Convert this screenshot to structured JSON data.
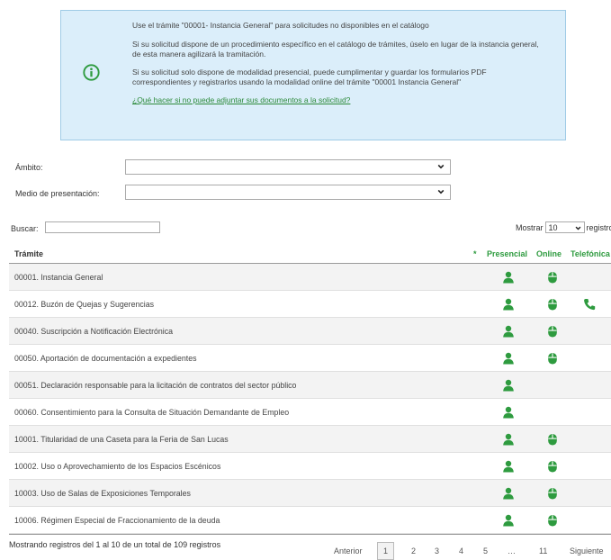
{
  "notice": {
    "line1": "Use el trámite \"00001- Instancia General\" para solicitudes no disponibles en el catálogo",
    "line2": "Si su solicitud dispone de un procedimiento específico en el catálogo de trámites, úselo en lugar de la instancia general, de esta manera agilizará la tramitación.",
    "line3": "Si su solicitud solo dispone de modalidad presencial, puede cumplimentar y guardar los formularios PDF correspondientes y registrarlos usando la modalidad online del trámite \"00001 Instancia General\"",
    "link": "¿Qué hacer si no puede adjuntar sus documentos a la solicitud?"
  },
  "filters": {
    "ambito_label": "Ámbito:",
    "ambito_value": "",
    "medio_label": "Medio de presentación:",
    "medio_value": ""
  },
  "search": {
    "label": "Buscar:",
    "value": ""
  },
  "page_size": {
    "label_before": "Mostrar",
    "value": "10",
    "label_after": "registros"
  },
  "table": {
    "headers": {
      "tramite": "Trámite",
      "star": "*",
      "presencial": "Presencial",
      "online": "Online",
      "telefonica": "Telefónica"
    },
    "rows": [
      {
        "name": "00001. Instancia General",
        "presencial": true,
        "online": true,
        "telefonica": false
      },
      {
        "name": "00012. Buzón de Quejas y Sugerencias",
        "presencial": true,
        "online": true,
        "telefonica": true
      },
      {
        "name": "00040. Suscripción a Notificación Electrónica",
        "presencial": true,
        "online": true,
        "telefonica": false
      },
      {
        "name": "00050. Aportación de documentación a expedientes",
        "presencial": true,
        "online": true,
        "telefonica": false
      },
      {
        "name": "00051. Declaración responsable para la licitación de contratos del sector público",
        "presencial": true,
        "online": false,
        "telefonica": false
      },
      {
        "name": "00060. Consentimiento para la Consulta de Situación Demandante de Empleo",
        "presencial": true,
        "online": false,
        "telefonica": false
      },
      {
        "name": "10001. Titularidad de una Caseta para la Feria de San Lucas",
        "presencial": true,
        "online": true,
        "telefonica": false
      },
      {
        "name": "10002. Uso o Aprovechamiento de los Espacios Escénicos",
        "presencial": true,
        "online": true,
        "telefonica": false
      },
      {
        "name": "10003. Uso de Salas de Exposiciones Temporales",
        "presencial": true,
        "online": true,
        "telefonica": false
      },
      {
        "name": "10006. Régimen Especial de Fraccionamiento de la deuda",
        "presencial": true,
        "online": true,
        "telefonica": false
      }
    ]
  },
  "footer": {
    "info": "Mostrando registros del 1 al 10 de un total de 109 registros",
    "pager": {
      "prev": "Anterior",
      "pages": [
        "1",
        "2",
        "3",
        "4",
        "5",
        "…",
        "11"
      ],
      "current": "1",
      "next": "Siguiente"
    }
  },
  "icons": {
    "presencial": "person-icon",
    "online": "mouse-icon",
    "telefonica": "phone-icon",
    "info": "info-circle-icon"
  },
  "colors": {
    "accent": "#2e9b3f",
    "notice_bg": "#dbeefa"
  }
}
